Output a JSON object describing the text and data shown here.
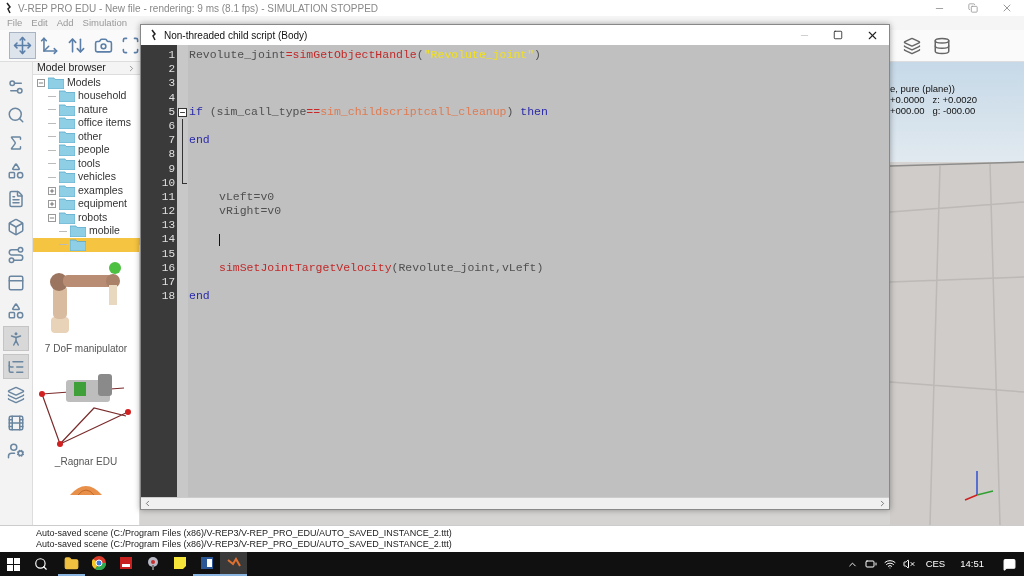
{
  "window": {
    "title": "V-REP PRO EDU - New file - rendering: 9 ms (8.1 fps) - SIMULATION STOPPED"
  },
  "menu": [
    "File",
    "Edit",
    "Add",
    "Simulation"
  ],
  "toolbar": [
    {
      "selected": true
    },
    {
      "selected": false
    },
    {
      "selected": false
    },
    {
      "selected": false
    },
    {
      "selected": false
    }
  ],
  "toolbar_right": [
    {
      "selected": false
    },
    {
      "selected": false
    }
  ],
  "left_toolbar": [
    {
      "selected": false
    },
    {
      "selected": false
    },
    {
      "selected": false
    },
    {
      "selected": false
    },
    {
      "selected": false
    },
    {
      "selected": false
    },
    {
      "selected": false
    },
    {
      "selected": false
    },
    {
      "selected": false
    },
    {
      "selected": true
    },
    {
      "selected": true
    },
    {
      "selected": false
    },
    {
      "selected": false
    },
    {
      "selected": false
    }
  ],
  "model_browser": {
    "title": "Model browser",
    "tree": [
      {
        "label": "Models",
        "expanded": true,
        "selected": false,
        "children": [
          {
            "label": "household",
            "selected": false
          },
          {
            "label": "nature",
            "selected": false
          },
          {
            "label": "office items",
            "selected": false
          },
          {
            "label": "other",
            "selected": false
          },
          {
            "label": "people",
            "selected": false
          },
          {
            "label": "tools",
            "selected": false
          },
          {
            "label": "vehicles",
            "selected": false
          },
          {
            "label": "examples",
            "expanded": false,
            "selected": false
          },
          {
            "label": "equipment",
            "expanded": false,
            "selected": false
          },
          {
            "label": "robots",
            "expanded": true,
            "selected": false,
            "children": [
              {
                "label": "mobile",
                "selected": false
              },
              {
                "selected": true
              }
            ]
          }
        ]
      }
    ],
    "models": [
      {
        "label": "7 DoF manipulator",
        "kind": "arm"
      },
      {
        "label": "_Ragnar EDU",
        "kind": "delta"
      },
      {
        "kind": "partial"
      }
    ]
  },
  "scene": {
    "info": [
      "e, pure (plane))",
      "+0.0000   z: +0.0020",
      "+000.00   g: -000.00"
    ]
  },
  "script_window": {
    "title": "Non-threaded child script (Body)",
    "minimize_disabled": true,
    "lines": [
      {
        "number": "1",
        "kind": "plain",
        "indented": false,
        "cursor": false,
        "tokens": [
          {
            "kind": "plain",
            "text": "Revolute_joint"
          },
          {
            "kind": "op",
            "text": "="
          },
          {
            "kind": "func",
            "text": "simGetObjectHandle"
          },
          {
            "kind": "plain",
            "text": "("
          },
          {
            "kind": "string",
            "text": "\"Revolute_joint\""
          },
          {
            "kind": "plain",
            "text": ")"
          }
        ]
      },
      {
        "number": "2",
        "kind": "plain"
      },
      {
        "number": "3",
        "kind": "plain"
      },
      {
        "number": "4",
        "kind": "plain"
      },
      {
        "number": "5",
        "kind": "open",
        "indented": false,
        "cursor": false,
        "tokens": [
          {
            "kind": "keyword",
            "text": "if"
          },
          {
            "kind": "plain",
            "text": " (sim_call_type"
          },
          {
            "kind": "op",
            "text": "=="
          },
          {
            "kind": "const",
            "text": "sim_childscriptcall_cleanup"
          },
          {
            "kind": "plain",
            "text": ") "
          },
          {
            "kind": "keyword",
            "text": "then"
          }
        ]
      },
      {
        "number": "6",
        "kind": "inside"
      },
      {
        "number": "7",
        "kind": "inside",
        "indented": false,
        "cursor": false,
        "tokens": [
          {
            "kind": "keyword",
            "text": "end"
          }
        ]
      },
      {
        "number": "8",
        "kind": "inside"
      },
      {
        "number": "9",
        "kind": "inside"
      },
      {
        "number": "10",
        "kind": "close"
      },
      {
        "number": "11",
        "kind": "plain",
        "indented": true,
        "cursor": false,
        "tokens": [
          {
            "kind": "plain",
            "text": "vLeft=v0"
          }
        ]
      },
      {
        "number": "12",
        "kind": "plain",
        "indented": true,
        "cursor": false,
        "tokens": [
          {
            "kind": "plain",
            "text": "vRight=v0"
          }
        ]
      },
      {
        "number": "13",
        "kind": "plain"
      },
      {
        "number": "14",
        "kind": "plain",
        "indented": true,
        "cursor": true
      },
      {
        "number": "15",
        "kind": "plain"
      },
      {
        "number": "16",
        "kind": "plain",
        "indented": true,
        "cursor": false,
        "tokens": [
          {
            "kind": "func",
            "text": "simSetJointTargetVelocity"
          },
          {
            "kind": "plain",
            "text": "(Revolute_joint,vLeft)"
          }
        ]
      },
      {
        "number": "17",
        "kind": "plain"
      },
      {
        "number": "18",
        "kind": "plain",
        "indented": false,
        "cursor": false,
        "tokens": [
          {
            "kind": "keyword",
            "text": "end"
          }
        ]
      }
    ]
  },
  "status_lines": [
    "Auto-saved scene (C:/Program Files (x86)/V-REP3/V-REP_PRO_EDU/AUTO_SAVED_INSTANCE_2.ttt)",
    "Auto-saved scene (C:/Program Files (x86)/V-REP3/V-REP_PRO_EDU/AUTO_SAVED_INSTANCE_2.ttt)"
  ],
  "taskbar": {
    "apps": [
      {
        "kind": "folder",
        "running": true,
        "selected": false
      },
      {
        "kind": "browser",
        "running": false,
        "selected": false
      },
      {
        "kind": "red",
        "running": false,
        "selected": false
      },
      {
        "kind": "tool",
        "running": false,
        "selected": false
      },
      {
        "kind": "notes",
        "running": false,
        "selected": false
      },
      {
        "kind": "word",
        "running": true,
        "selected": false
      },
      {
        "kind": "vrep",
        "running": true,
        "selected": true
      }
    ],
    "language": "CES",
    "time": "14:51"
  }
}
